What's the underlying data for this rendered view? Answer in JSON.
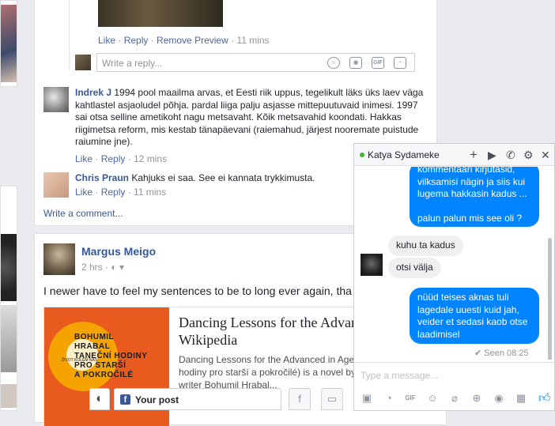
{
  "preview_comment": {
    "like": "Like",
    "reply": "Reply",
    "remove_preview": "Remove Preview",
    "time": "11 mins"
  },
  "reply_box": {
    "placeholder": "Write a reply..."
  },
  "comments": [
    {
      "author": "Indrek J",
      "text": "1994 pool maailma arvas, et Eesti riik uppus, tegelikult läks üks laev väga kahtlastel asjaoludel põhja. pardal liiga palju asjasse mittepuutuvaid inimesi. 1997 sai otsa selline ametikoht nagu metsavaht. Kõik metsavahid koondati. Hakkas riigimetsa reform, mis kestab tänapäevani (raiemahud, järjest nooremate puistude raiumine jne).",
      "like": "Like",
      "reply": "Reply",
      "time": "12 mins"
    },
    {
      "author": "Chris Praun",
      "text": "Kahjuks ei saa. See ei kannata trykkimusta.",
      "like": "Like",
      "reply": "Reply",
      "time": "11 mins"
    }
  ],
  "write_comment": "Write a comment...",
  "post": {
    "author": "Margus Meigo",
    "time": "2 hrs",
    "text": "I newer have to feel my sentences to be to long ever again, tha",
    "link_title": "Dancing Lessons for the Advanced in Age - Wikipedia",
    "link_desc": "Dancing Lessons for the Advanced in Age (Czech: Taneční hodiny pro starší a pokročilé) is a novel by the Czechoslovak writer Bohumil Hrabal...",
    "cover_lines": [
      "BOHUMIL",
      "HRABAL",
      "TANEČNÍ HODINY",
      "PRO STARŠÍ",
      "A POKROČILÉ"
    ],
    "cover_small": "ŽIVOT KOLEM NÁS"
  },
  "chat": {
    "name": "Katya Sydameke",
    "messages": [
      {
        "dir": "out",
        "text": "kommentaari kirjutasid, vilksamisi nägin ja siis kui lugema hakkasin kadus ...\n\npalun palun mis see oli ?"
      },
      {
        "dir": "in",
        "text": "kuhu ta kadus"
      },
      {
        "dir": "in",
        "text": "otsi välja"
      },
      {
        "dir": "out",
        "text": "nüüd teises aknas tuli lagedale uuesti kuid jah, veider et sedasi kaob otse laadimisel"
      }
    ],
    "seen": "Seen 08:25",
    "input_placeholder": "Type a message..."
  },
  "bottombar": {
    "your_post": "Your post"
  },
  "colors": {
    "accent": "#365899",
    "messenger_blue": "#0084ff",
    "online": "#42b72a"
  }
}
